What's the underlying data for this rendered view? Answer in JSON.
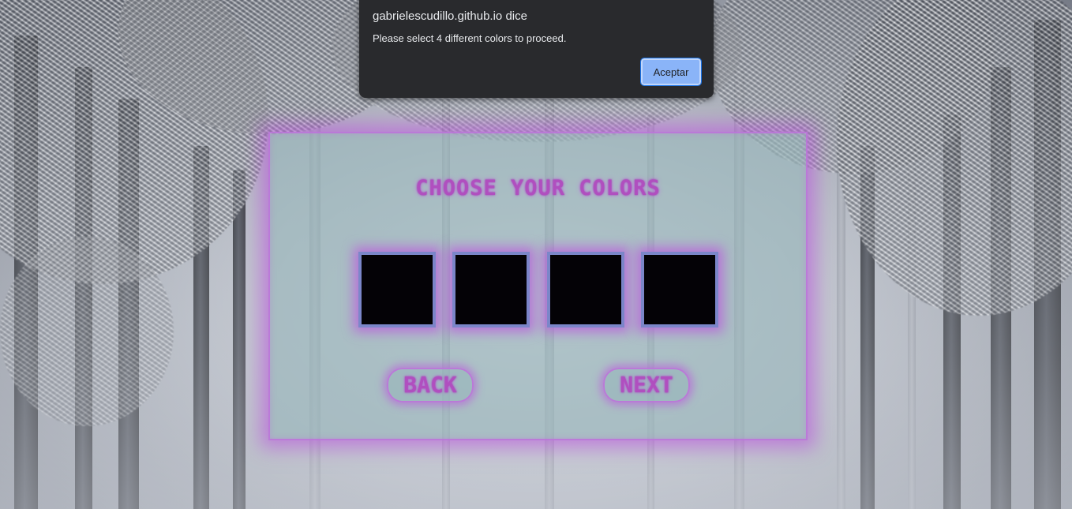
{
  "alert": {
    "origin": "gabrielescudillo.github.io dice",
    "message": "Please select 4 different colors to proceed.",
    "ok_label": "Aceptar"
  },
  "panel": {
    "title": "CHOOSE YOUR COLORS",
    "swatches": [
      {
        "label": "color-1",
        "color": "#040206"
      },
      {
        "label": "color-2",
        "color": "#040206"
      },
      {
        "label": "color-3",
        "color": "#040206"
      },
      {
        "label": "color-4",
        "color": "#040206"
      }
    ],
    "back_label": "BACK",
    "next_label": "NEXT"
  },
  "colors": {
    "accent": "#b04fbf",
    "glow": "#ba5adc",
    "swatch_border": "#7b86c9",
    "panel_bg": "#96b4ba",
    "dialog_bg": "#292a2d",
    "dialog_button": "#8ab4f8"
  }
}
